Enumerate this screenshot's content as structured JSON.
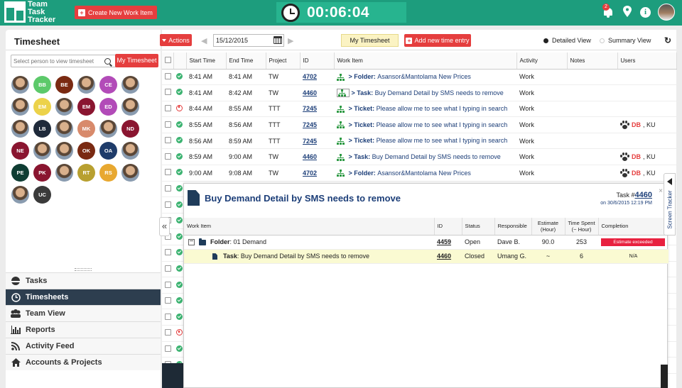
{
  "header": {
    "logo_line1": "Team",
    "logo_line2": "Task",
    "logo_line3": "Tracker",
    "create_button": "Create New Work Item",
    "timer": "00:06:04",
    "notification_count": "2"
  },
  "left_panel": {
    "title": "Timesheet",
    "search_placeholder": "Select person to view timesheet",
    "my_timesheet_button": "My Timesheet",
    "avatars": [
      {
        "initials": "",
        "color": "photo"
      },
      {
        "initials": "BB",
        "color": "#5cc96a"
      },
      {
        "initials": "BE",
        "color": "#7a2a12"
      },
      {
        "initials": "",
        "color": "photo"
      },
      {
        "initials": "CE",
        "color": "#b24bb8"
      },
      {
        "initials": "",
        "color": "photo"
      },
      {
        "initials": "",
        "color": "photo"
      },
      {
        "initials": "EM",
        "color": "#ecd24a"
      },
      {
        "initials": "",
        "color": "photo"
      },
      {
        "initials": "EM",
        "color": "#8a1530"
      },
      {
        "initials": "ED",
        "color": "#b24bb8"
      },
      {
        "initials": "",
        "color": "photo"
      },
      {
        "initials": "",
        "color": "photo"
      },
      {
        "initials": "LB",
        "color": "#1f2a3a"
      },
      {
        "initials": "",
        "color": "photo"
      },
      {
        "initials": "MK",
        "color": "#d88a6b"
      },
      {
        "initials": "",
        "color": "photo"
      },
      {
        "initials": "ND",
        "color": "#8a1530"
      },
      {
        "initials": "NE",
        "color": "#8a1530"
      },
      {
        "initials": "",
        "color": "photo"
      },
      {
        "initials": "",
        "color": "photo"
      },
      {
        "initials": "OK",
        "color": "#7a2a12"
      },
      {
        "initials": "OA",
        "color": "#1f3c6a"
      },
      {
        "initials": "",
        "color": "photo"
      },
      {
        "initials": "PE",
        "color": "#0f3d33"
      },
      {
        "initials": "PK",
        "color": "#8a1530"
      },
      {
        "initials": "",
        "color": "photo"
      },
      {
        "initials": "RT",
        "color": "#b8a030"
      },
      {
        "initials": "RS",
        "color": "#e8a830"
      },
      {
        "initials": "",
        "color": "photo"
      },
      {
        "initials": "",
        "color": "photo"
      },
      {
        "initials": "UC",
        "color": "#3a3a3a"
      }
    ],
    "nav": [
      "Tasks",
      "Timesheets",
      "Team View",
      "Reports",
      "Activity Feed",
      "Accounts & Projects"
    ]
  },
  "toolbar": {
    "actions": "Actions",
    "date": "15/12/2015",
    "my_timesheet_tab": "My Timesheet",
    "add_entry": "Add new time entry",
    "detailed_view": "Detailed View",
    "summary_view": "Summary View"
  },
  "table": {
    "headers": [
      "Start Time",
      "End Time",
      "Project",
      "ID",
      "Work Item",
      "Activity",
      "Notes",
      "Users"
    ],
    "rows": [
      {
        "status": "ok",
        "start": "8:41 AM",
        "end": "8:41 AM",
        "project": "TW",
        "id": "4702",
        "kind": "Folder",
        "title": "Asansor&Mantolama New Prices",
        "activity": "Work",
        "users_db": "",
        "users_rest": ""
      },
      {
        "status": "ok",
        "start": "8:41 AM",
        "end": "8:42 AM",
        "project": "TW",
        "id": "4460",
        "kind": "Task",
        "title": "Buy Demand Detail by SMS needs to remove",
        "activity": "Work",
        "users_db": "",
        "users_rest": ""
      },
      {
        "status": "time",
        "start": "8:44 AM",
        "end": "8:55 AM",
        "project": "TTT",
        "id": "7245",
        "kind": "Ticket",
        "title": "Please allow me to see what I typing in search",
        "activity": "Work",
        "users_db": "",
        "users_rest": ""
      },
      {
        "status": "ok",
        "start": "8:55 AM",
        "end": "8:56 AM",
        "project": "TTT",
        "id": "7245",
        "kind": "Ticket",
        "title": "Please allow me to see what I typing in search",
        "activity": "Work",
        "users_db": "DB",
        "users_rest": ", KU"
      },
      {
        "status": "ok",
        "start": "8:56 AM",
        "end": "8:59 AM",
        "project": "TTT",
        "id": "7245",
        "kind": "Ticket",
        "title": "Please allow me to see what I typing in search",
        "activity": "Work",
        "users_db": "",
        "users_rest": ""
      },
      {
        "status": "ok",
        "start": "8:59 AM",
        "end": "9:00 AM",
        "project": "TW",
        "id": "4460",
        "kind": "Task",
        "title": "Buy Demand Detail by SMS needs to remove",
        "activity": "Work",
        "users_db": "DB",
        "users_rest": ", KU"
      },
      {
        "status": "ok",
        "start": "9:00 AM",
        "end": "9:08 AM",
        "project": "TW",
        "id": "4702",
        "kind": "Folder",
        "title": "Asansor&Mantolama New Prices",
        "activity": "Work",
        "users_db": "DB",
        "users_rest": ", KU"
      }
    ],
    "hidden_status": [
      "ok",
      "ok",
      "ok",
      "ok",
      "ok",
      "ok",
      "ok",
      "ok",
      "ok",
      "time",
      "ok",
      "ok"
    ]
  },
  "popup": {
    "title": "Buy Demand Detail by SMS needs to remove",
    "task_label": "Task #",
    "task_id": "4460",
    "task_on": "on 30/6/2015 12:19 PM",
    "close": "×",
    "headers": [
      "Work Item",
      "ID",
      "Status",
      "Responsible",
      "Estimate (Hour)",
      "Time Spent (~ Hour)",
      "Completion"
    ],
    "rows": [
      {
        "kind": "Folder",
        "title": "01 Demand",
        "id": "4459",
        "status": "Open",
        "responsible": "Dave B.",
        "estimate": "90.0",
        "spent": "253",
        "completion": "Estimate exceeded"
      },
      {
        "kind": "Task",
        "title": "Buy Demand Detail by SMS needs to remove",
        "id": "4460",
        "status": "Closed",
        "responsible": "Umang G.",
        "estimate": "~",
        "spent": "6",
        "completion": "N/A"
      }
    ]
  },
  "screen_tracker": "Screen Tracker"
}
